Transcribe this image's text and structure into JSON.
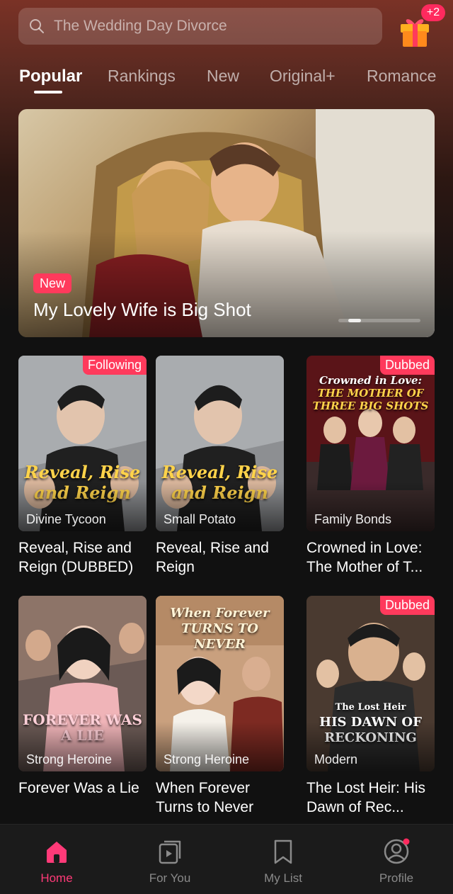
{
  "search": {
    "placeholder": "The Wedding Day Divorce"
  },
  "gift": {
    "icon": "gift-icon",
    "badge": "+2"
  },
  "tabs": [
    {
      "label": "Popular",
      "active": true
    },
    {
      "label": "Rankings"
    },
    {
      "label": "New"
    },
    {
      "label": "Original+"
    },
    {
      "label": "Romance"
    }
  ],
  "banner": {
    "tag": "New",
    "title": "My Lovely Wife is Big Shot",
    "slide_count": 2
  },
  "cards": [
    {
      "badge": "Following",
      "genre": "Divine Tycoon",
      "title": "Reveal, Rise and Reign (DUBBED)",
      "cover_text": "Reveal, Rise and Reign"
    },
    {
      "badge": "",
      "genre": "Small Potato",
      "title": "Reveal, Rise and Reign",
      "cover_text": "Reveal, Rise and Reign"
    },
    {
      "badge": "Dubbed",
      "genre": "Family Bonds",
      "title": "Crowned in Love: The Mother of T...",
      "cover_text_top": "Crowned in Love:",
      "cover_text_main": "THE MOTHER OF THREE BIG SHOTS"
    },
    {
      "badge": "",
      "genre": "Strong Heroine",
      "title": "Forever Was a Lie",
      "cover_text": "FOREVER WAS A LIE"
    },
    {
      "badge": "",
      "genre": "Strong Heroine",
      "title": "When Forever Turns to Never",
      "cover_text": "When Forever TURNS TO NEVER"
    },
    {
      "badge": "Dubbed",
      "genre": "Modern",
      "title": "The Lost Heir: His Dawn of Rec...",
      "cover_text_top": "The Lost Heir",
      "cover_text_main": "HIS DAWN OF RECKONING"
    }
  ],
  "nav": [
    {
      "label": "Home",
      "icon": "home-icon",
      "active": true
    },
    {
      "label": "For You",
      "icon": "play-cards-icon"
    },
    {
      "label": "My List",
      "icon": "bookmark-icon"
    },
    {
      "label": "Profile",
      "icon": "profile-icon",
      "dot": true
    }
  ],
  "colors": {
    "accent": "#ff3a5c",
    "nav_active": "#ff3a78",
    "background": "#111111"
  }
}
